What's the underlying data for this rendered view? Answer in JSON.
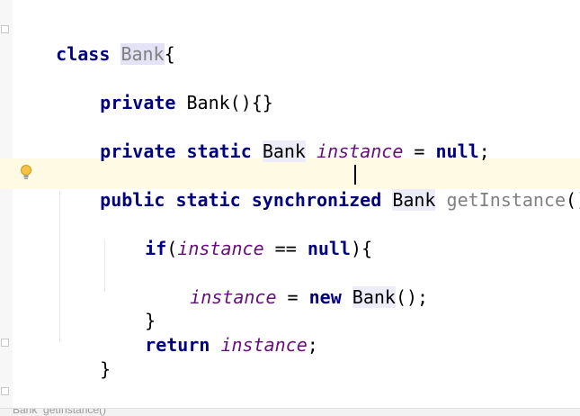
{
  "editor": {
    "lines": {
      "l1": {
        "kw_class": "class",
        "cls_name": "Bank",
        "brace": "{"
      },
      "l2": {
        "kw_private": "private",
        "ctor": "Bank(){}"
      },
      "l3": {
        "kw_private": "private",
        "kw_static": "static",
        "type": "Bank",
        "field": "instance",
        "eq": " = ",
        "kw_null": "null",
        "semi": ";"
      },
      "l4": {
        "kw_public": "public",
        "kw_static": "static",
        "kw_sync": "synchronized",
        "type": "Bank",
        "method": "getInstance",
        "params": "(){"
      },
      "l5": {
        "kw_if": "if",
        "open": "(",
        "field": "instance",
        "op": " == ",
        "kw_null": "null",
        "close": "){"
      },
      "l6": {
        "field": "instance",
        "eq": " = ",
        "kw_new": "new",
        "type": "Bank",
        "rest": "();"
      },
      "l7": {
        "brace": "}"
      },
      "l8": {
        "kw_return": "return",
        "field": "instance",
        "semi": ";"
      },
      "l9": {
        "brace": "}"
      },
      "l10": {
        "brace": "}"
      }
    },
    "breadcrumb": "Bank  getInstance()"
  },
  "colors": {
    "keyword": "#000080",
    "field": "#660e7a",
    "unused": "#808080",
    "caret_row": "#fffae3"
  },
  "icons": {
    "intention": "lightbulb-icon"
  }
}
